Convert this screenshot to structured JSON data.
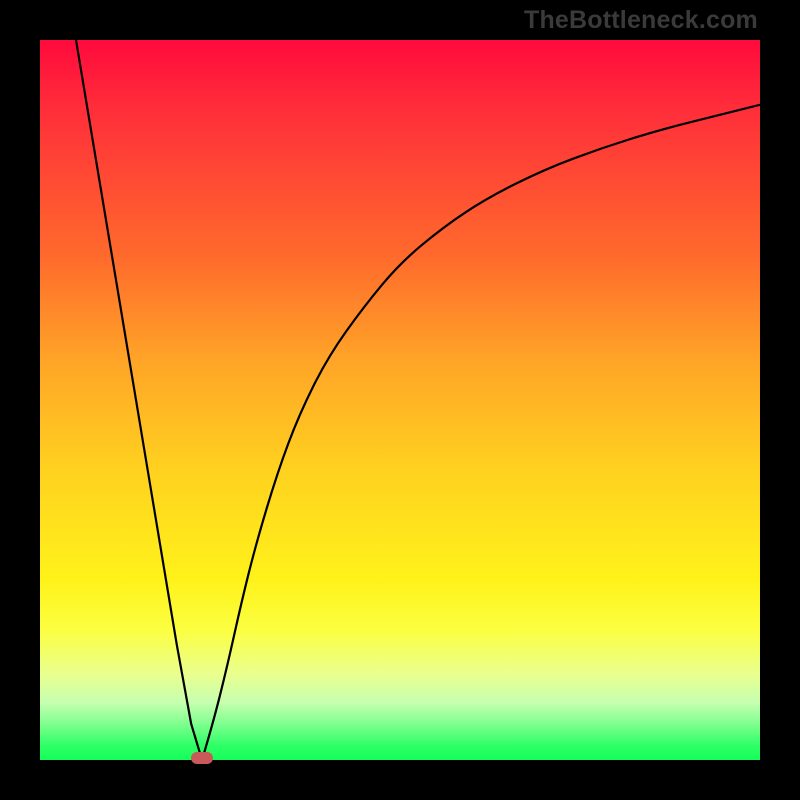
{
  "watermark": {
    "text": "TheBottleneck.com"
  },
  "chart_data": {
    "type": "line",
    "title": "",
    "xlabel": "",
    "ylabel": "",
    "xlim": [
      0,
      100
    ],
    "ylim": [
      0,
      100
    ],
    "grid": false,
    "legend": false,
    "series": [
      {
        "name": "left-branch",
        "x": [
          5,
          7,
          9,
          11,
          13,
          15,
          17,
          19,
          21,
          22.5
        ],
        "values": [
          100,
          88,
          76,
          64,
          52,
          40,
          28,
          16,
          5,
          0
        ]
      },
      {
        "name": "right-branch",
        "x": [
          22.5,
          24,
          26,
          28,
          30,
          33,
          36,
          40,
          45,
          50,
          56,
          62,
          70,
          78,
          86,
          94,
          100
        ],
        "values": [
          0,
          5,
          13,
          22,
          30,
          40,
          48,
          56,
          63,
          69,
          74,
          78,
          82,
          85,
          87.5,
          89.5,
          91
        ]
      }
    ],
    "marker": {
      "x": 22.5,
      "y": 0,
      "color": "#c85a5a",
      "shape": "rounded-rect"
    },
    "background_gradient": {
      "type": "vertical",
      "stops": [
        {
          "pos": 0.0,
          "color": "#ff0a3c"
        },
        {
          "pos": 0.3,
          "color": "#ff6a2c"
        },
        {
          "pos": 0.6,
          "color": "#ffd21f"
        },
        {
          "pos": 0.82,
          "color": "#fbff41"
        },
        {
          "pos": 0.95,
          "color": "#7fff8f"
        },
        {
          "pos": 1.0,
          "color": "#14ff5a"
        }
      ]
    }
  }
}
